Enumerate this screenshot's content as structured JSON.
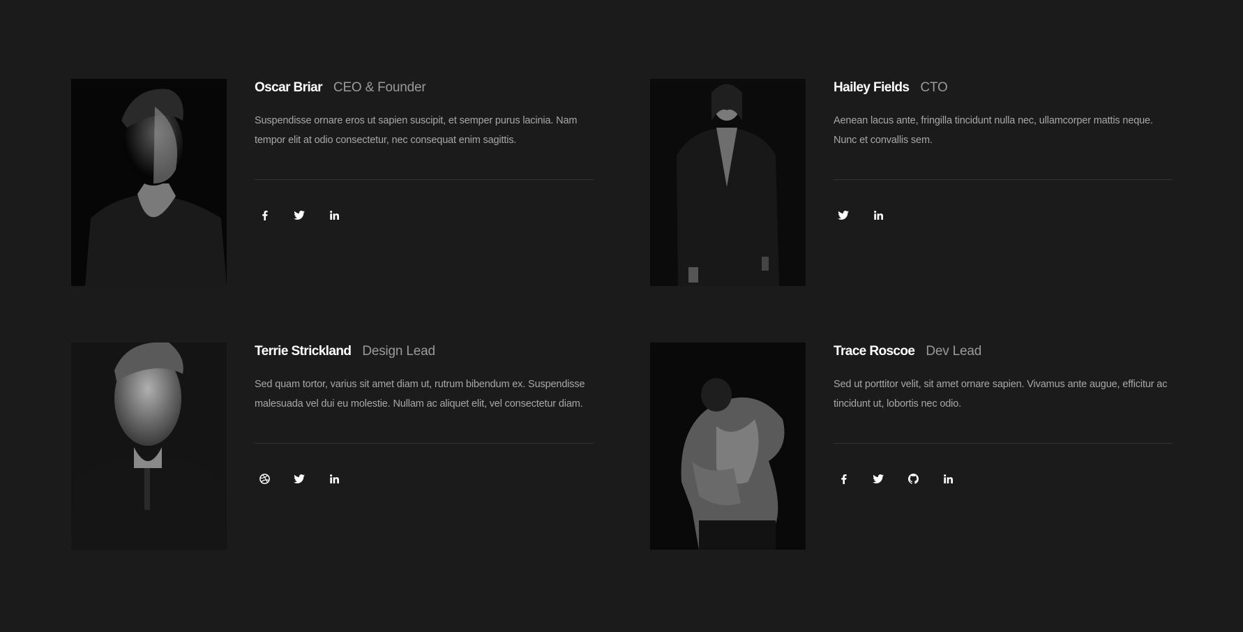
{
  "team": [
    {
      "name": "Oscar Briar",
      "role": "CEO & Founder",
      "bio": "Suspendisse ornare eros ut sapien suscipit, et semper purus lacinia. Nam tempor elit at odio consectetur, nec consequat enim sagittis.",
      "socials": [
        "facebook-icon",
        "twitter-icon",
        "linkedin-icon"
      ]
    },
    {
      "name": "Hailey Fields",
      "role": "CTO",
      "bio": "Aenean lacus ante, fringilla tincidunt nulla nec, ullamcorper mattis neque. Nunc et convallis sem.",
      "socials": [
        "twitter-icon",
        "linkedin-icon"
      ]
    },
    {
      "name": "Terrie Strickland",
      "role": "Design Lead",
      "bio": "Sed quam tortor, varius sit amet diam ut, rutrum bibendum ex. Suspendisse malesuada vel dui eu molestie. Nullam ac aliquet elit, vel consectetur diam.",
      "socials": [
        "dribbble-icon",
        "twitter-icon",
        "linkedin-icon"
      ]
    },
    {
      "name": "Trace Roscoe",
      "role": "Dev Lead",
      "bio": "Sed ut porttitor velit, sit amet ornare sapien. Vivamus ante augue, efficitur ac tincidunt ut, lobortis nec odio.",
      "socials": [
        "facebook-icon",
        "twitter-icon",
        "github-icon",
        "linkedin-icon"
      ]
    }
  ],
  "colors": {
    "background": "#1b1b1b",
    "name": "#ffffff",
    "role": "#9a9a9a",
    "bio": "#a8a8a8",
    "divider": "#343434"
  }
}
